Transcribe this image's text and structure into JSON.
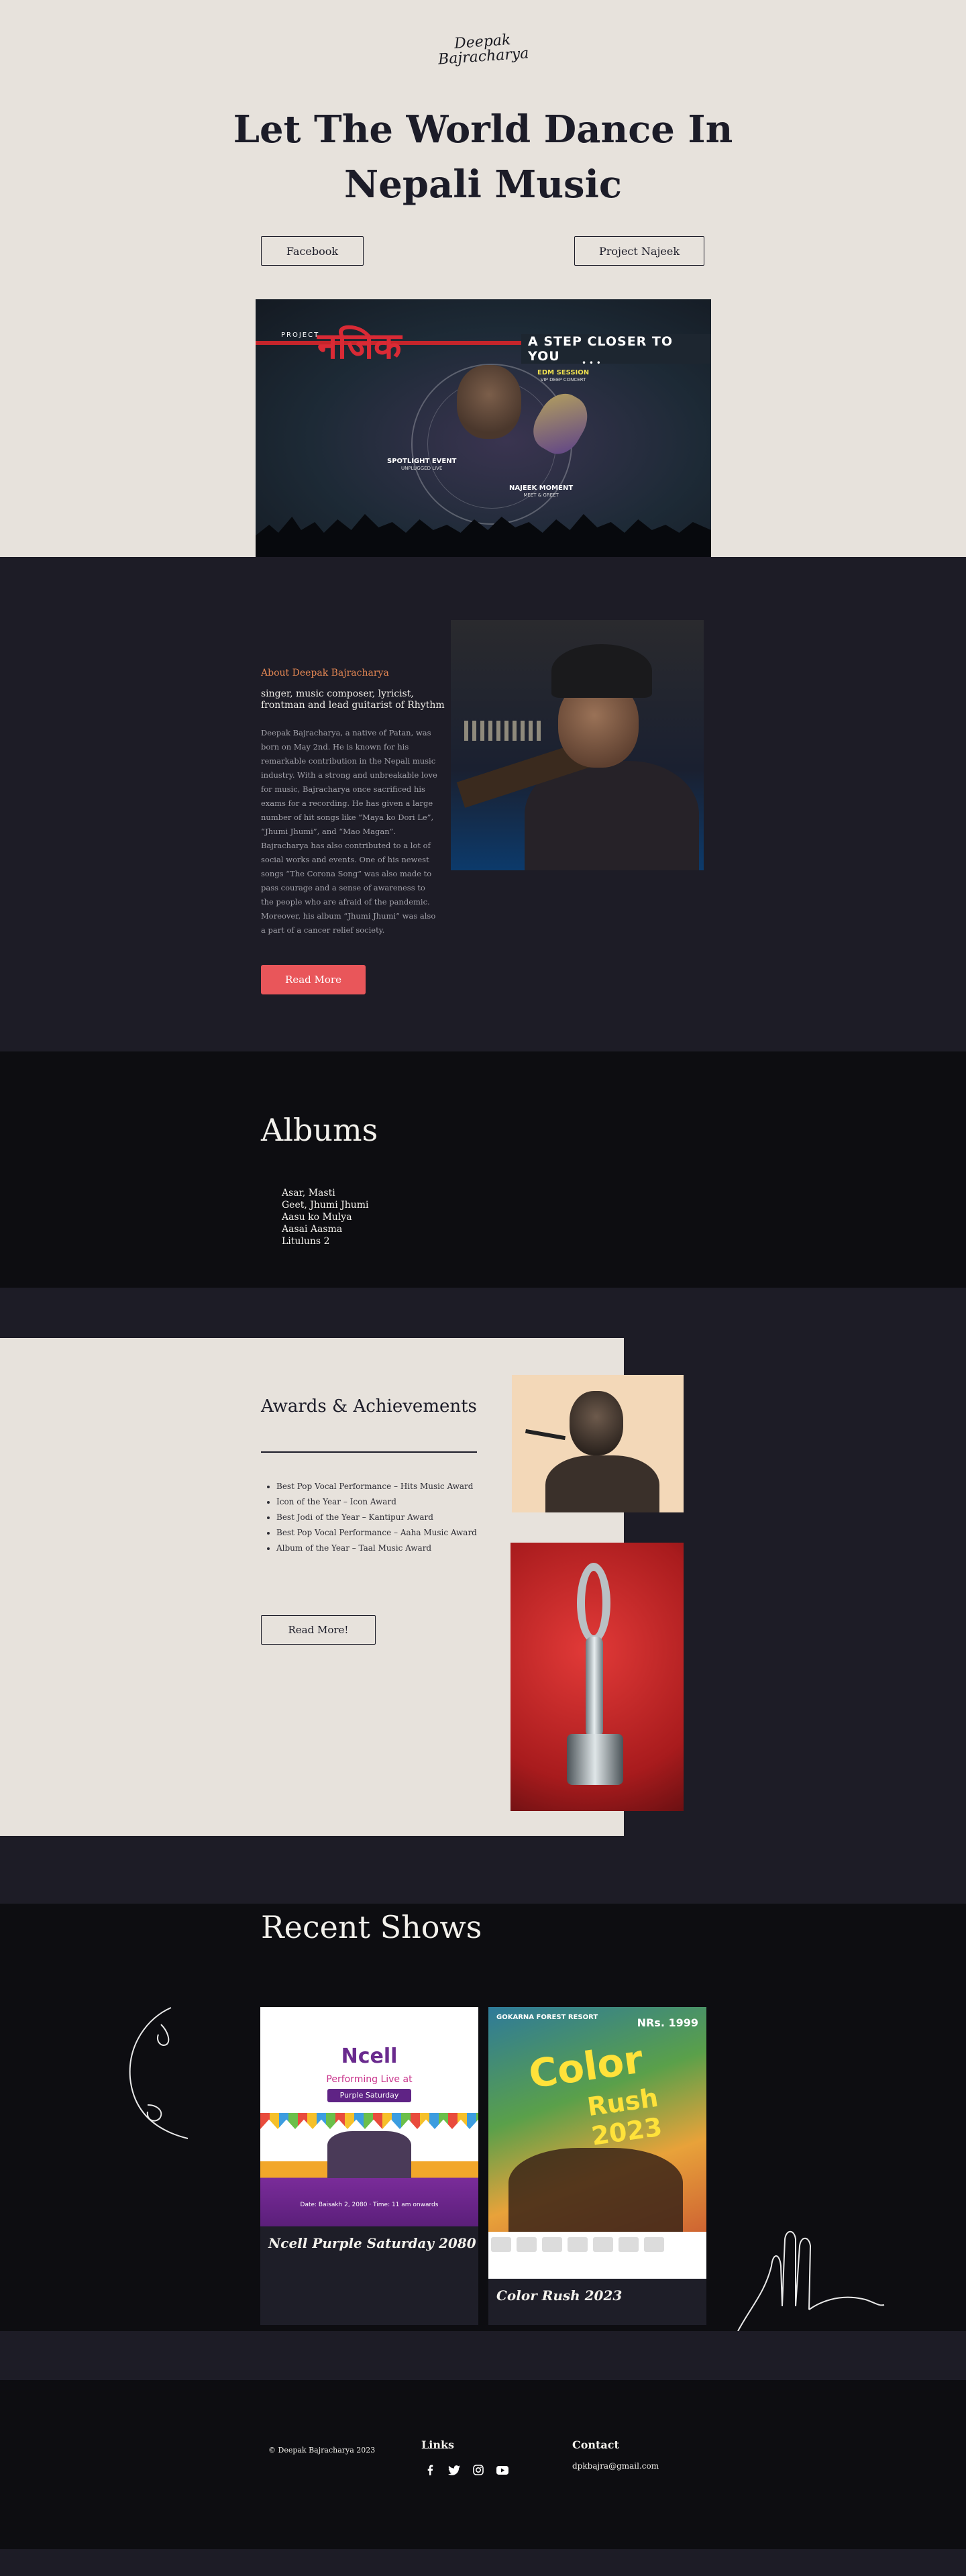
{
  "header": {
    "logo_line1": "Deepak",
    "logo_line2": "Bajracharya",
    "title_line1": "Let The World Dance In",
    "title_line2": "Nepali Music",
    "facebook_label": "Facebook",
    "project_label": "Project Najeek"
  },
  "banner": {
    "project_small": "PROJECT",
    "project_big": "नजिक",
    "tagline": "A STEP CLOSER TO YOU",
    "edm_title": "EDM SESSION",
    "edm_sub": "VIP DEEP CONCERT",
    "spotlight_title": "SPOTLIGHT EVENT",
    "spotlight_sub": "UNPLUGGED LIVE",
    "najeek_title": "NAJEEK MOMENT",
    "najeek_sub": "MEET & GREET",
    "dots": "• • •"
  },
  "about": {
    "kicker": "About Deepak Bajracharya",
    "subtitle": "singer, music composer, lyricist, frontman and lead guitarist of Rhythm",
    "body": "Deepak Bajracharya, a native of Patan, was born on May 2nd. He is known for his remarkable contribution in the Nepali music industry. With a strong and unbreakable love for music, Bajracharya once sacrificed his exams for a recording. He has given a large number of hit songs like “Maya ko Dori Le”, “Jhumi Jhumi”, and “Mao Magan”. Bajracharya has also contributed to a lot of social works and events. One of his newest songs “The Corona Song” was also made to pass courage and a sense of awareness to the people who are afraid of the pandemic. Moreover, his album “Jhumi Jhumi” was also a part of a cancer relief society.",
    "read_more": "Read More"
  },
  "albums": {
    "title": "Albums",
    "items": [
      "Asar, Masti",
      "Geet, Jhumi Jhumi",
      "Aasu ko Mulya",
      "Aasai Aasma",
      "Lituluns 2"
    ]
  },
  "awards": {
    "title": "Awards & Achievements",
    "items": [
      "Best Pop Vocal Performance – Hits Music Award",
      "Icon of the Year – Icon Award",
      "Best Jodi of the Year – Kantipur Award",
      "Best Pop Vocal Performance – Aaha Music Award",
      "Album of the Year – Taal Music Award"
    ],
    "button": "Read More!"
  },
  "shows": {
    "title": "Recent Shows",
    "cards": [
      {
        "title": "Ncell Purple Saturday 2080",
        "brand": "Ncell",
        "line1": "Performing Live at",
        "line2": "Purple Saturday",
        "line3": "Date: Baisakh 2, 2080 · Time: 11 am onwards"
      },
      {
        "title": "Color Rush 2023",
        "brand_top": "GOKARNA FOREST RESORT",
        "headline": "Color",
        "headline2": "Rush 2023",
        "price": "NRs. 1999"
      }
    ]
  },
  "footer": {
    "copyright": "© Deepak Bajracharya 2023",
    "links_title": "Links",
    "contact_title": "Contact",
    "email": "dpkbajra@gmail.com"
  },
  "colors": {
    "hero_bg": "#e7e2dc",
    "dark_bg": "#1d1c26",
    "darker_bg": "#0d0d11",
    "accent": "#e9565a",
    "kicker": "#e28653"
  }
}
